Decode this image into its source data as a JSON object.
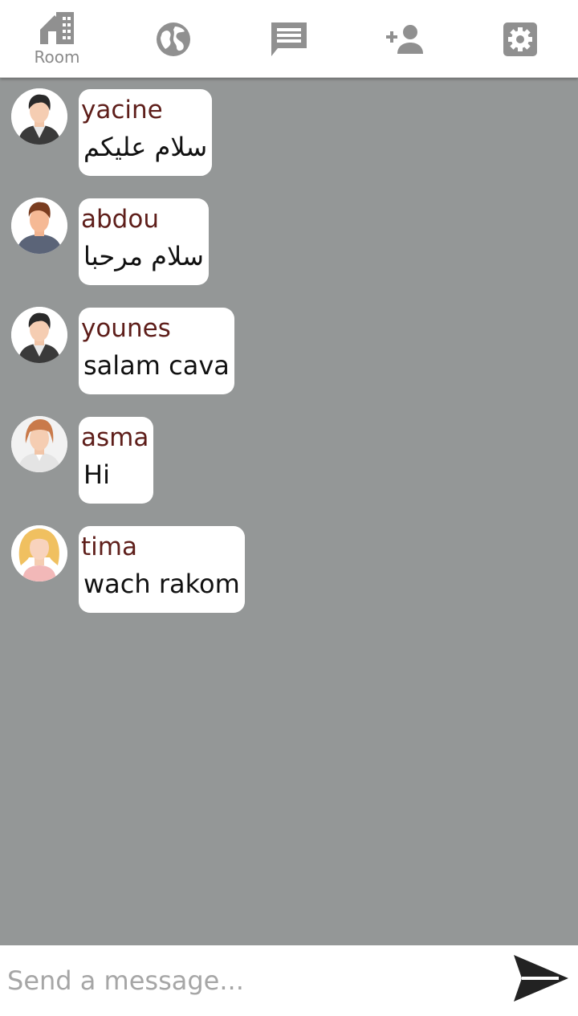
{
  "nav": {
    "items": [
      {
        "icon": "room-icon",
        "label": "Room"
      },
      {
        "icon": "globe-icon",
        "label": ""
      },
      {
        "icon": "chat-icon",
        "label": ""
      },
      {
        "icon": "add-user-icon",
        "label": ""
      },
      {
        "icon": "settings-icon",
        "label": ""
      }
    ],
    "icon_color": "#909090"
  },
  "messages": [
    {
      "sender": "yacine",
      "text": "سلام عليكم",
      "avatar": "male-suit-avatar"
    },
    {
      "sender": "abdou",
      "text": "سلام مرحبا",
      "avatar": "male-sweater-avatar"
    },
    {
      "sender": "younes",
      "text": "salam cava",
      "avatar": "male-suit-avatar"
    },
    {
      "sender": "asma",
      "text": "Hi",
      "avatar": "female-short-hair-avatar"
    },
    {
      "sender": "tima",
      "text": "wach rakom",
      "avatar": "female-blonde-avatar"
    }
  ],
  "composer": {
    "placeholder": "Send a message...",
    "send_icon": "send-icon"
  },
  "colors": {
    "background": "#949797",
    "sender_name": "#5e1e1a",
    "bubble": "#ffffff",
    "send_icon": "#222222"
  }
}
